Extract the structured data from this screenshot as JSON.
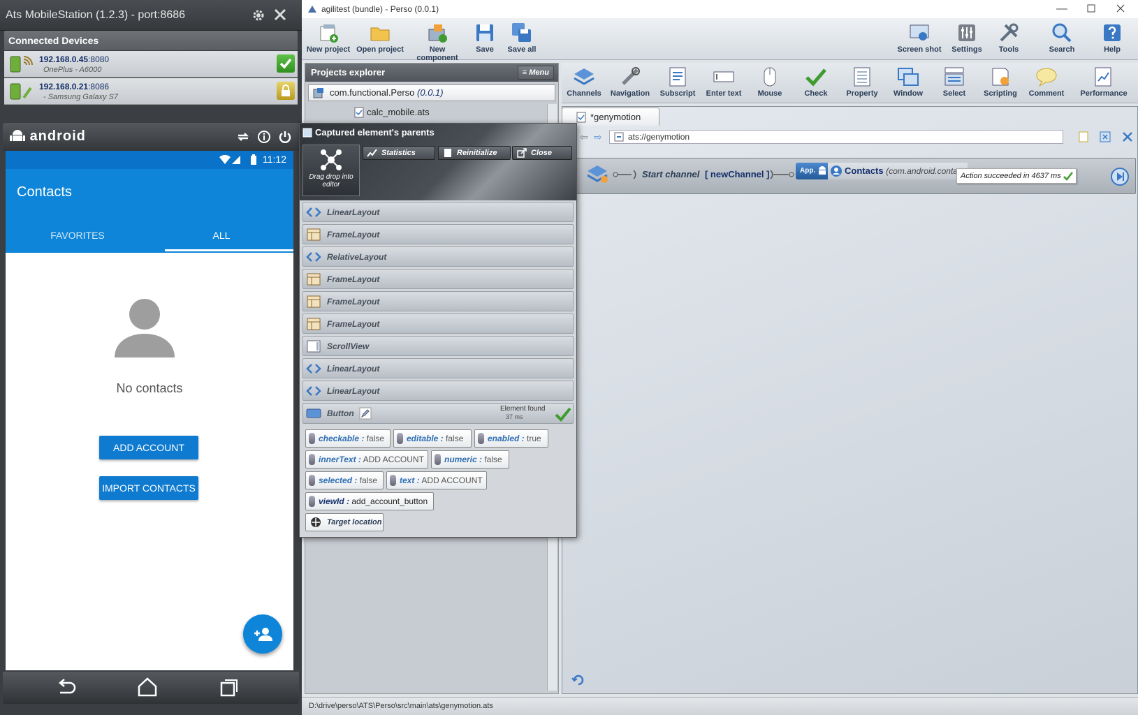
{
  "mobile_station": {
    "title": "Ats MobileStation (1.2.3) - port:8686",
    "connected_devices_label": "Connected Devices",
    "devices": [
      {
        "ip": "192.168.0.45",
        "port": ":8080",
        "model": "OnePlus - A6000",
        "status": "connected"
      },
      {
        "ip": "192.168.0.21",
        "port": ":8086",
        "model": "- Samsung Galaxy S7",
        "status": "locked"
      }
    ],
    "android_label": "android"
  },
  "phone": {
    "clock": "11:12",
    "app_title": "Contacts",
    "tabs": [
      "FAVORITES",
      "ALL"
    ],
    "empty_message": "No contacts",
    "add_account_label": "ADD ACCOUNT",
    "import_contacts_label": "IMPORT CONTACTS"
  },
  "agilitest": {
    "window_title": "agilitest (bundle) - Perso (0.0.1)",
    "toolbar_left": [
      "New project",
      "Open project",
      "New component",
      "Save",
      "Save all"
    ],
    "toolbar_right": [
      "Screen shot",
      "Settings",
      "Tools",
      "Search",
      "Help"
    ],
    "actions": [
      "Channels",
      "Navigation",
      "Subscript",
      "Enter text",
      "Mouse",
      "Check",
      "Property",
      "Window",
      "Select",
      "Scripting",
      "Comment",
      "Performance"
    ],
    "explorer": {
      "title": "Projects explorer",
      "menu_label": "Menu",
      "project_name": "com.functional.Perso",
      "project_version": "(0.0.1)",
      "file": "calc_mobile.ats"
    },
    "editor": {
      "tab_label": "*genymotion",
      "url": "ats://genymotion",
      "start_channel": "Start channel",
      "channel_name": "[ newChannel ]",
      "app_chip": "App.",
      "contacts_label": "Contacts",
      "contacts_package": "(com.android.contacts",
      "success_message": "Action succeeded in 4637 ms"
    },
    "status_path": "D:\\drive\\perso\\ATS\\Perso\\src\\main\\ats\\genymotion.ats"
  },
  "captured": {
    "title": "Captured element's parents",
    "drag_label": "Drag drop into editor",
    "buttons": [
      "Statistics",
      "Reinitialize",
      "Close"
    ],
    "parents": [
      {
        "name": "LinearLayout",
        "kind": "linear"
      },
      {
        "name": "FrameLayout",
        "kind": "frame"
      },
      {
        "name": "RelativeLayout",
        "kind": "linear"
      },
      {
        "name": "FrameLayout",
        "kind": "frame"
      },
      {
        "name": "FrameLayout",
        "kind": "frame"
      },
      {
        "name": "FrameLayout",
        "kind": "frame"
      },
      {
        "name": "ScrollView",
        "kind": "scroll"
      },
      {
        "name": "LinearLayout",
        "kind": "linear"
      },
      {
        "name": "LinearLayout",
        "kind": "linear"
      }
    ],
    "element": {
      "name": "Button",
      "found_label": "Element found",
      "found_time": "37 ms"
    },
    "properties": [
      {
        "key": "checkable :",
        "value": "false"
      },
      {
        "key": "editable :",
        "value": "false"
      },
      {
        "key": "enabled :",
        "value": "true"
      },
      {
        "key": "innerText :",
        "value": "ADD ACCOUNT"
      },
      {
        "key": "numeric :",
        "value": "false"
      },
      {
        "key": "selected :",
        "value": "false"
      },
      {
        "key": "text :",
        "value": "ADD ACCOUNT"
      },
      {
        "key": "viewId :",
        "value": "add_account_button"
      }
    ],
    "target_location_label": "Target location"
  }
}
